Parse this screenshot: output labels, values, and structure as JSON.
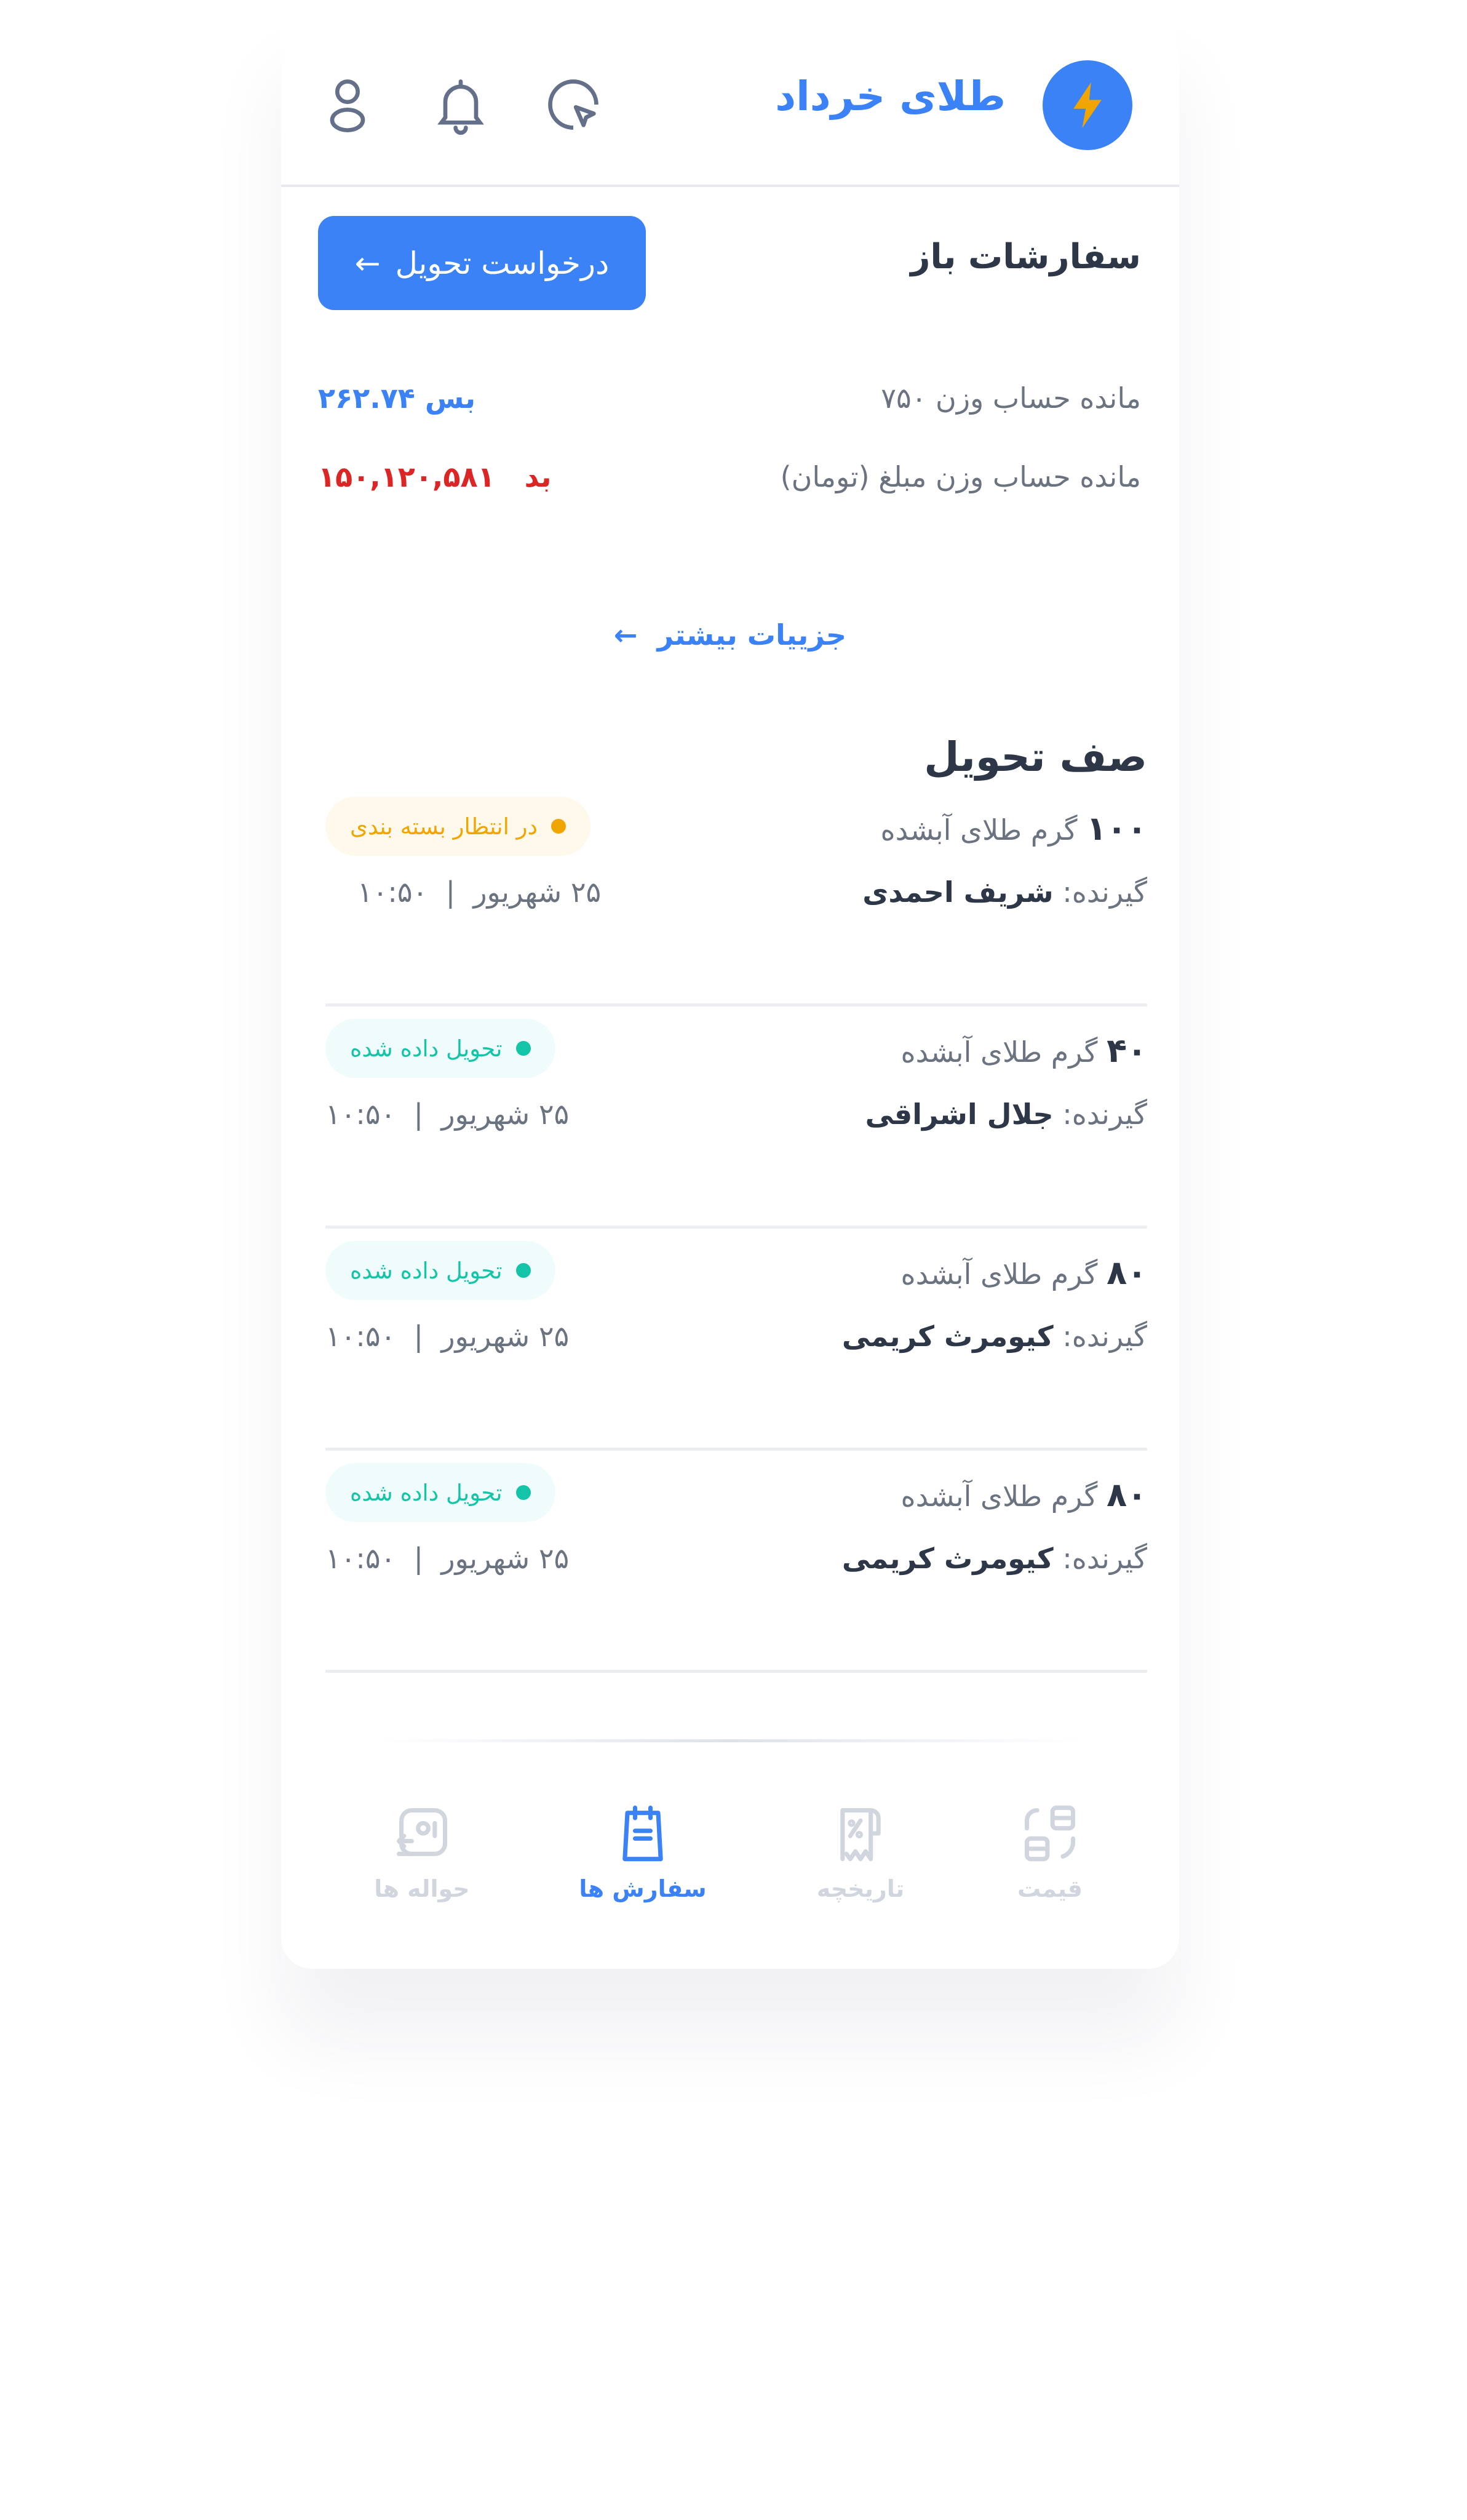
{
  "header": {
    "brand": "طلای خرداد",
    "logo_icon": "lightning-icon",
    "icons": [
      "chart-pie-icon",
      "bell-icon",
      "user-icon"
    ]
  },
  "open_orders": {
    "title": "سفارشات  باز",
    "request_button": "درخواست تحویل",
    "arrow_icon": "arrow-left-icon"
  },
  "balances": [
    {
      "label": "مانده حساب وزن ۷۵۰",
      "value": "بس ۲۶۲.۷۴",
      "color": "#3b82f6"
    },
    {
      "label": "مانده حساب وزن مبلغ (تومان)",
      "value": "بد   ۱۵۰,۱۲۰,۵۸۱",
      "color": "#dc2626"
    }
  ],
  "more_link": "جزییات بیشتر",
  "queue": {
    "title": "صف تحویل",
    "items": [
      {
        "amount": "۱۰۰",
        "unit": "گرم طلای آبشده",
        "receiver_label": "گیرنده:",
        "receiver": "شریف احمدی",
        "date": "۲۵ شهریور  |  ۱۰:۵۰",
        "status": "در انتظار بسته بندی",
        "status_color": "#f0a500",
        "status_bg": "#fff9ec"
      },
      {
        "amount": "۴۰",
        "unit": "گرم طلای آبشده",
        "receiver_label": "گیرنده:",
        "receiver": "جلال اشراقی",
        "date": "۲۵ شهریور  |  ۱۰:۵۰",
        "status": "تحویل داده شده",
        "status_color": "#14c4a8",
        "status_bg": "#f0fcfb"
      },
      {
        "amount": "۸۰",
        "unit": "گرم طلای آبشده",
        "receiver_label": "گیرنده:",
        "receiver": "کیومرث کریمی",
        "date": "۲۵ شهریور  |  ۱۰:۵۰",
        "status": "تحویل داده شده",
        "status_color": "#14c4a8",
        "status_bg": "#f0fcfb"
      },
      {
        "amount": "۸۰",
        "unit": "گرم طلای آبشده",
        "receiver_label": "گیرنده:",
        "receiver": "کیومرث کریمی",
        "date": "۲۵ شهریور  |  ۱۰:۵۰",
        "status": "تحویل داده شده",
        "status_color": "#14c4a8",
        "status_bg": "#f0fcfb"
      }
    ]
  },
  "nav": [
    {
      "label": "قیمت",
      "icon": "price-icon",
      "active": false
    },
    {
      "label": "تاریخچه",
      "icon": "receipt-icon",
      "active": false
    },
    {
      "label": "سفارش ها",
      "icon": "notepad-icon",
      "active": true
    },
    {
      "label": "حواله ها",
      "icon": "transfer-icon",
      "active": false
    }
  ],
  "colors": {
    "accent": "#3b82f6",
    "text_dark": "#2d3748",
    "text_muted": "#6b7280",
    "nav_inactive": "#d1d5de",
    "logo_bolt": "#f0a500"
  }
}
